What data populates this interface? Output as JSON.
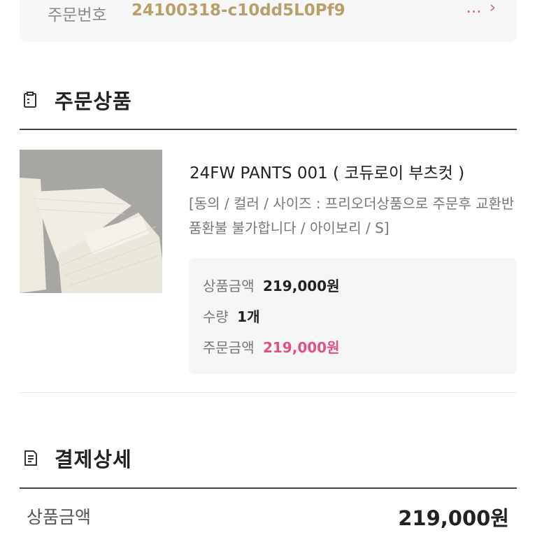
{
  "order": {
    "label": "주문번호",
    "number": "24100318-c10dd5L0Pf9",
    "link_text": "..."
  },
  "sections": {
    "ordered_items_title": "주문상품",
    "payment_details_title": "결제상세"
  },
  "product": {
    "name": "24FW PANTS 001 ( 코듀로이 부츠컷 )",
    "options": "[동의 / 컬러 / 사이즈 : 프리오더상품으로 주문후 교환반품환불 불가합니다 / 아이보리 / S]",
    "image_alt": "ivory corduroy bootcut pants",
    "price_label": "상품금액",
    "price_value": "219,000원",
    "qty_label": "수량",
    "qty_value": "1개",
    "order_amount_label": "주문금액",
    "order_amount_value": "219,000원"
  },
  "payment": {
    "product_amount_label": "상품금액",
    "product_amount_value": "219,000원"
  },
  "colors": {
    "accent_pink": "#e05283",
    "order_number_gold": "#b9a06a"
  },
  "icons": {
    "ordered_items": "clipboard-icon",
    "payment_details": "receipt-icon"
  }
}
